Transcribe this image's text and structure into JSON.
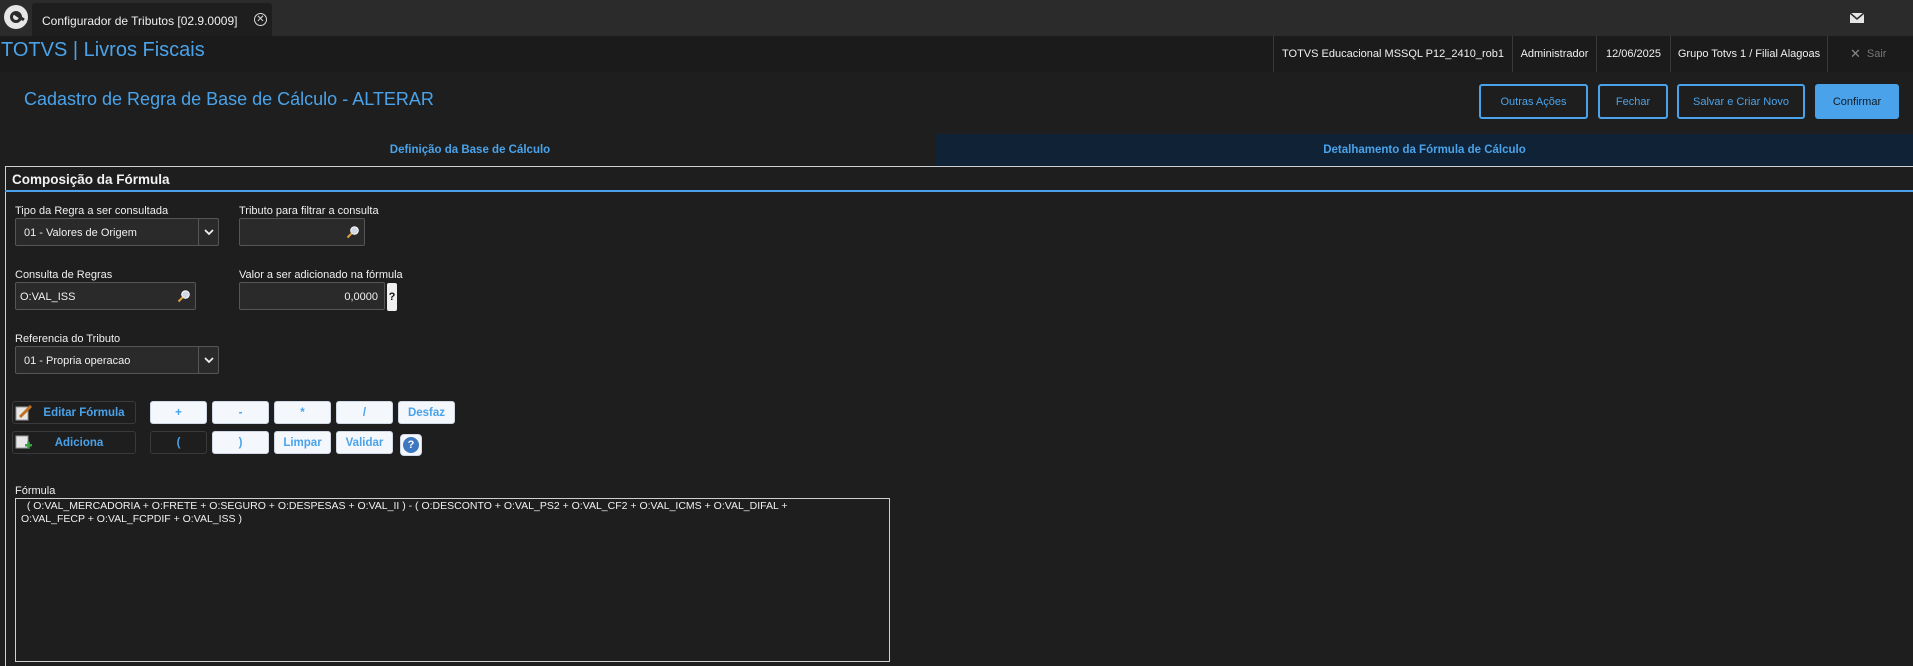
{
  "tabbar": {
    "window_tab": "Configurador de Tributos [02.9.0009]",
    "close_glyph": "✕",
    "mail_icon": "mail-icon"
  },
  "header": {
    "app_title": "TOTVS | Livros Fiscais",
    "environment": "TOTVS Educacional MSSQL P12_2410_rob1",
    "user": "Administrador",
    "date": "12/06/2025",
    "branch": "Grupo Totvs 1 / Filial Alagoas",
    "logout_label": "Sair"
  },
  "page": {
    "title": "Cadastro de Regra de Base de Cálculo - ALTERAR",
    "actions": {
      "other": "Outras Ações",
      "close": "Fechar",
      "save_new": "Salvar e Criar Novo",
      "confirm": "Confirmar"
    }
  },
  "folders": {
    "tab1": "Definição da Base de Cálculo",
    "tab2": "Detalhamento da Fórmula de Cálculo"
  },
  "section": {
    "title": "Composição da Fórmula"
  },
  "form": {
    "tipo_label": "Tipo da Regra a ser consultada",
    "tipo_value": "01 - Valores de Origem",
    "tributo_label": "Tributo para filtrar a consulta",
    "tributo_value": "",
    "consulta_label": "Consulta de Regras",
    "consulta_value": "O:VAL_ISS",
    "valor_label": "Valor a ser adicionado na fórmula",
    "valor_value": "0,0000",
    "valor_help": "?",
    "referencia_label": "Referencia do Tributo",
    "referencia_value": "01 - Propria operacao"
  },
  "formula_buttons": {
    "editar": "Editar Fórmula",
    "adiciona": "Adiciona",
    "plus": "+",
    "minus": "-",
    "times": "*",
    "divide": "/",
    "desfaz": "Desfaz",
    "open_paren": "(",
    "close_paren": ")",
    "limpar": "Limpar",
    "validar": "Validar",
    "help": "?"
  },
  "formula": {
    "label": "Fórmula",
    "text": "  ( O:VAL_MERCADORIA + O:FRETE + O:SEGURO + O:DESPESAS + O:VAL_II ) - ( O:DESCONTO + O:VAL_PS2 + O:VAL_CF2 + O:VAL_ICMS + O:VAL_DIFAL +\nO:VAL_FECP + O:VAL_FCPDIF + O:VAL_ISS )"
  },
  "colors": {
    "accent": "#4aa3ea",
    "background": "#1e1e1e",
    "active_tab": "#0f2236"
  }
}
